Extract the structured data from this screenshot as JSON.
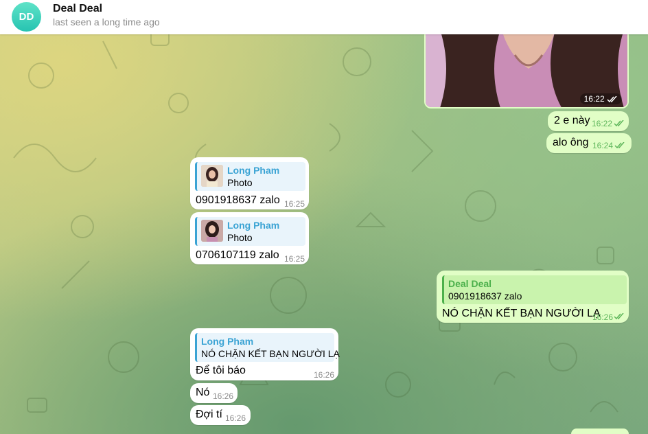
{
  "header": {
    "avatar_initials": "DD",
    "title": "Deal Deal",
    "status": "last seen a long time ago"
  },
  "colors": {
    "incoming_bubble": "#ffffff",
    "outgoing_bubble": "#e1fec6",
    "reply_accent_incoming": "#3aa3d4",
    "reply_accent_outgoing": "#4bb04b",
    "avatar": "#27c3b1"
  },
  "messages": [
    {
      "direction": "out",
      "type": "photo",
      "time": "16:22",
      "status_icon": "double-check-icon"
    },
    {
      "direction": "out",
      "text": "2 e này",
      "time": "16:22",
      "status_icon": "double-check-icon"
    },
    {
      "direction": "out",
      "text": "alo ông",
      "time": "16:24",
      "status_icon": "double-check-icon"
    },
    {
      "direction": "in",
      "reply": {
        "name": "Long Pham",
        "text": "Photo"
      },
      "text": "0901918637 zalo",
      "time": "16:25"
    },
    {
      "direction": "in",
      "reply": {
        "name": "Long Pham",
        "text": "Photo"
      },
      "text": "0706107119 zalo",
      "time": "16:25"
    },
    {
      "direction": "out",
      "reply": {
        "name": "Deal Deal",
        "text": "0901918637 zalo"
      },
      "text": "NÓ CHẶN KẾT BẠN NGƯỜI LẠ",
      "time": "16:26",
      "status_icon": "double-check-icon"
    },
    {
      "direction": "in",
      "reply": {
        "name": "Long Pham",
        "text": "NÓ CHẶN KẾT BẠN NGƯỜI LẠ"
      },
      "text": "Để tôi báo",
      "time": "16:26"
    },
    {
      "direction": "in",
      "text": "Nó",
      "time": "16:26"
    },
    {
      "direction": "in",
      "text": "Đợi tí",
      "time": "16:26"
    }
  ]
}
